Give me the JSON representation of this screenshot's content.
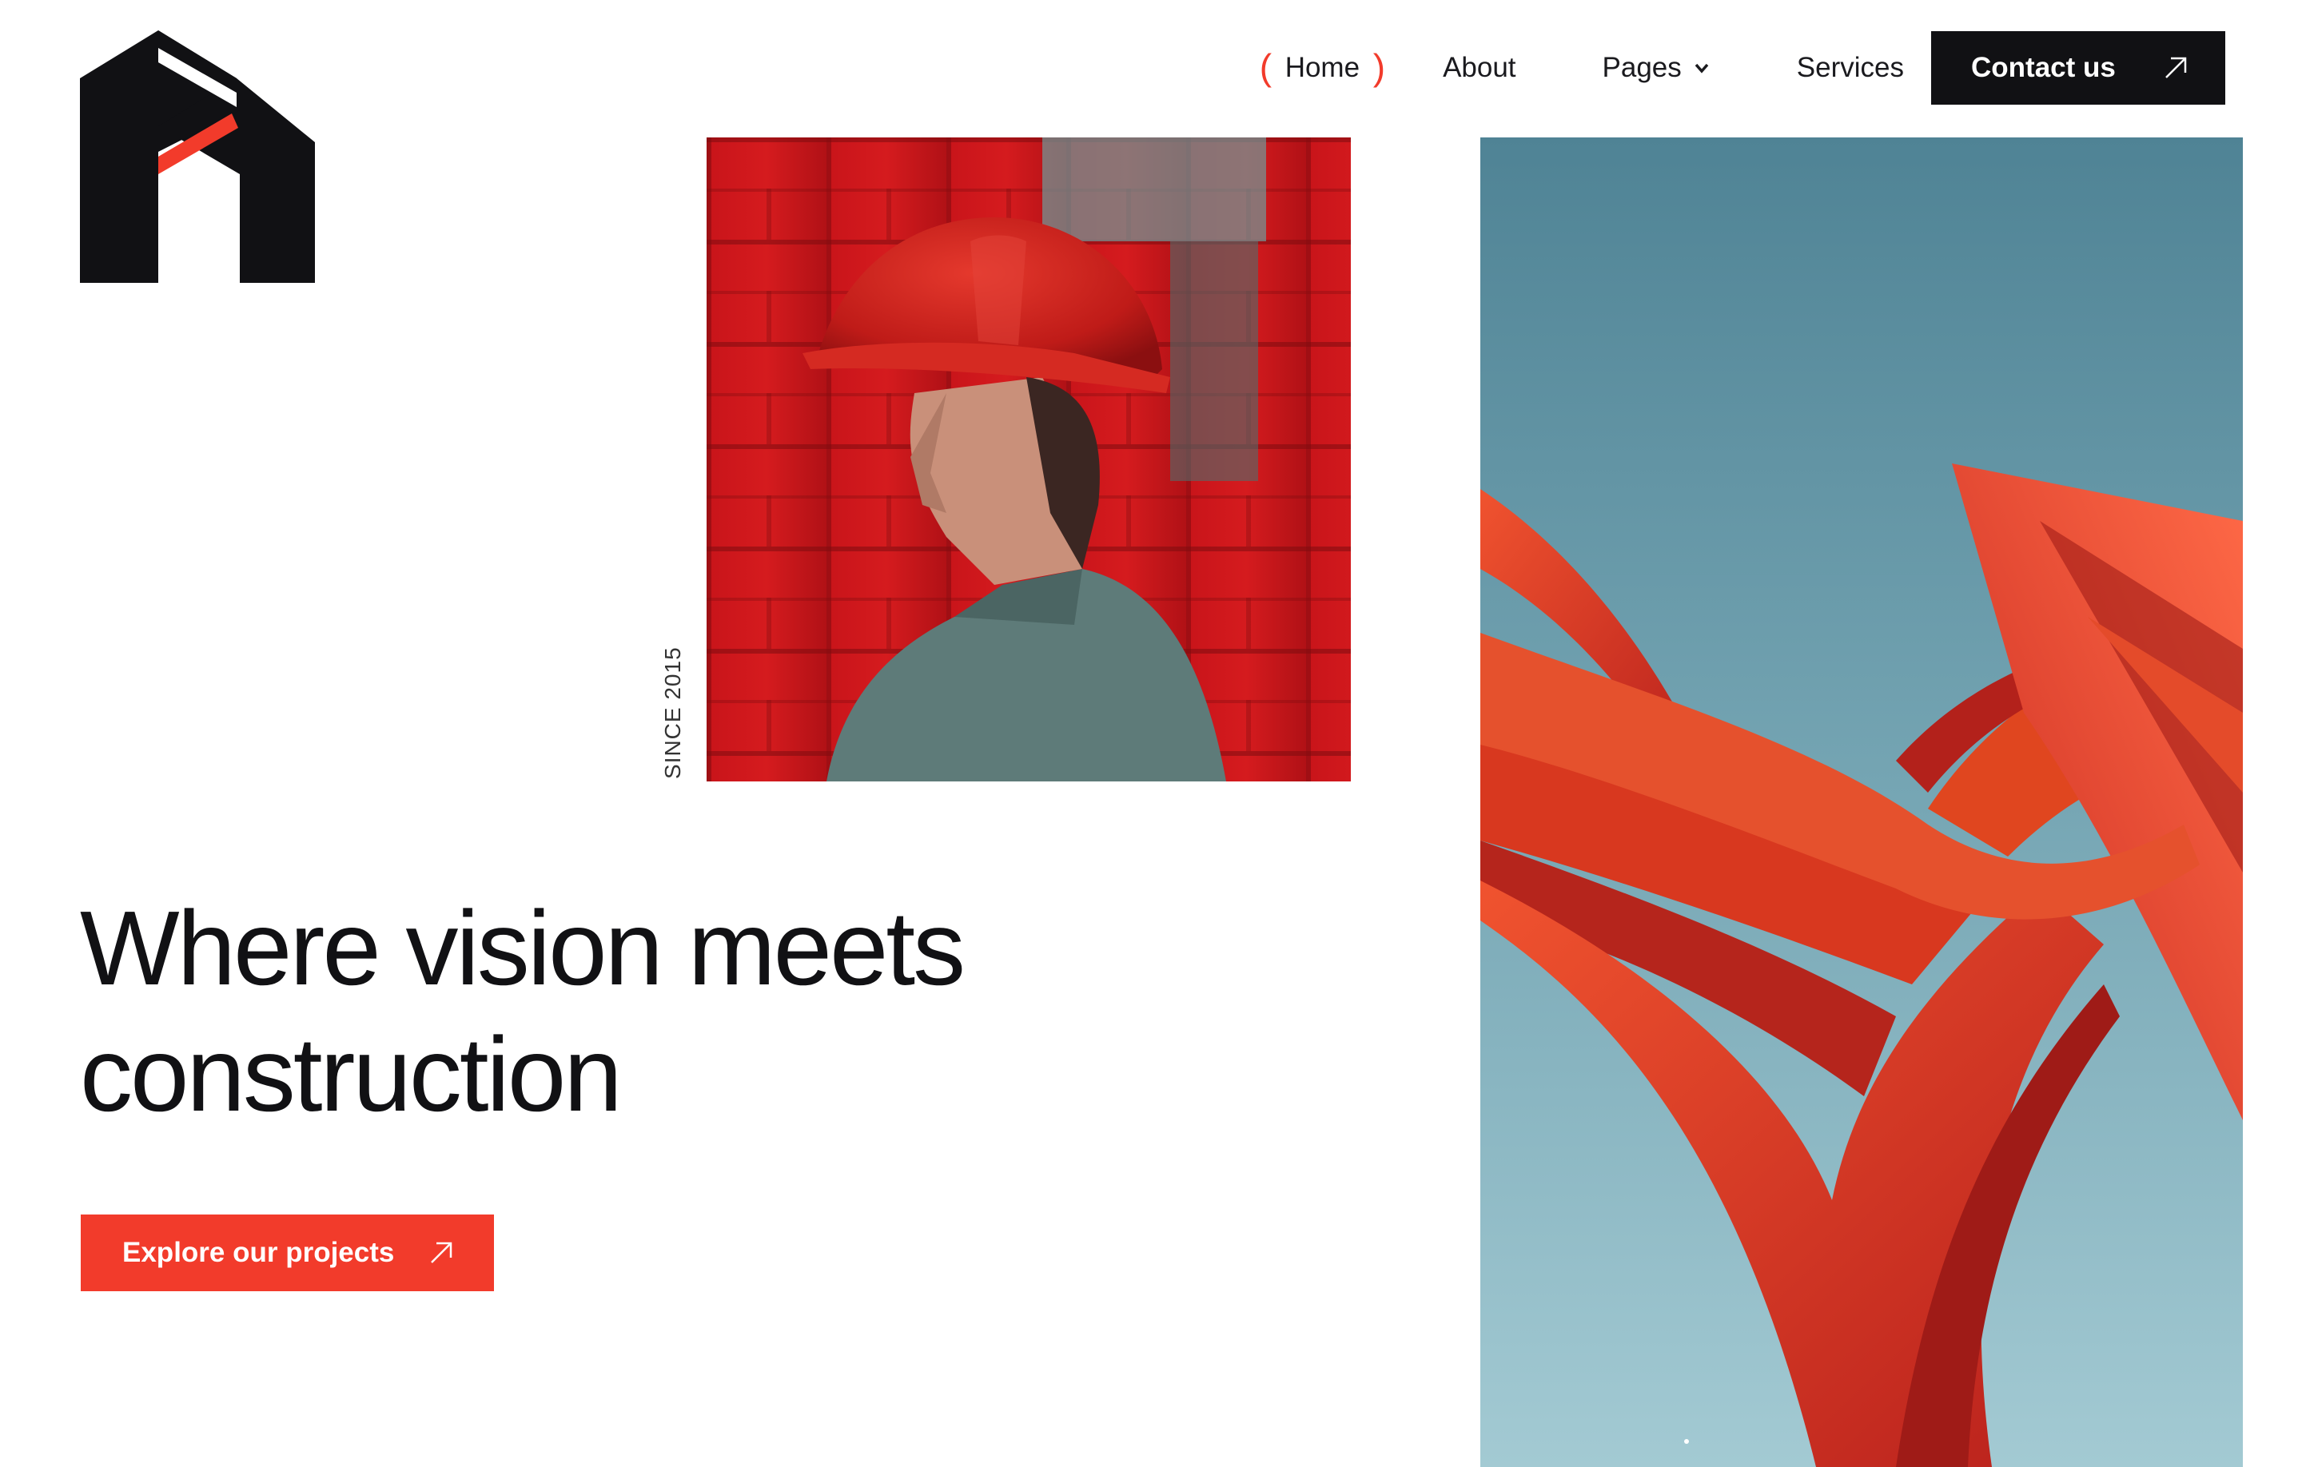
{
  "brand": {
    "logo": "house-a-logo",
    "accent": "#f23b2b",
    "dark": "#111114"
  },
  "nav": {
    "items": [
      {
        "label": "Home",
        "active": true
      },
      {
        "label": "About"
      },
      {
        "label": "Pages",
        "icon": "chevron-down-icon"
      },
      {
        "label": "Services"
      }
    ],
    "cta": {
      "label": "Contact us",
      "icon": "arrow-up-right-icon"
    }
  },
  "hero": {
    "since": "SINCE 2015",
    "line1": "Where vision meets",
    "line2": "construction",
    "cta": {
      "label": "Explore our projects",
      "icon": "arrow-up-right-icon"
    }
  },
  "images": {
    "worker": "worker-red-hardhat-photo",
    "sculpture": "red-steel-sculpture-photo"
  }
}
